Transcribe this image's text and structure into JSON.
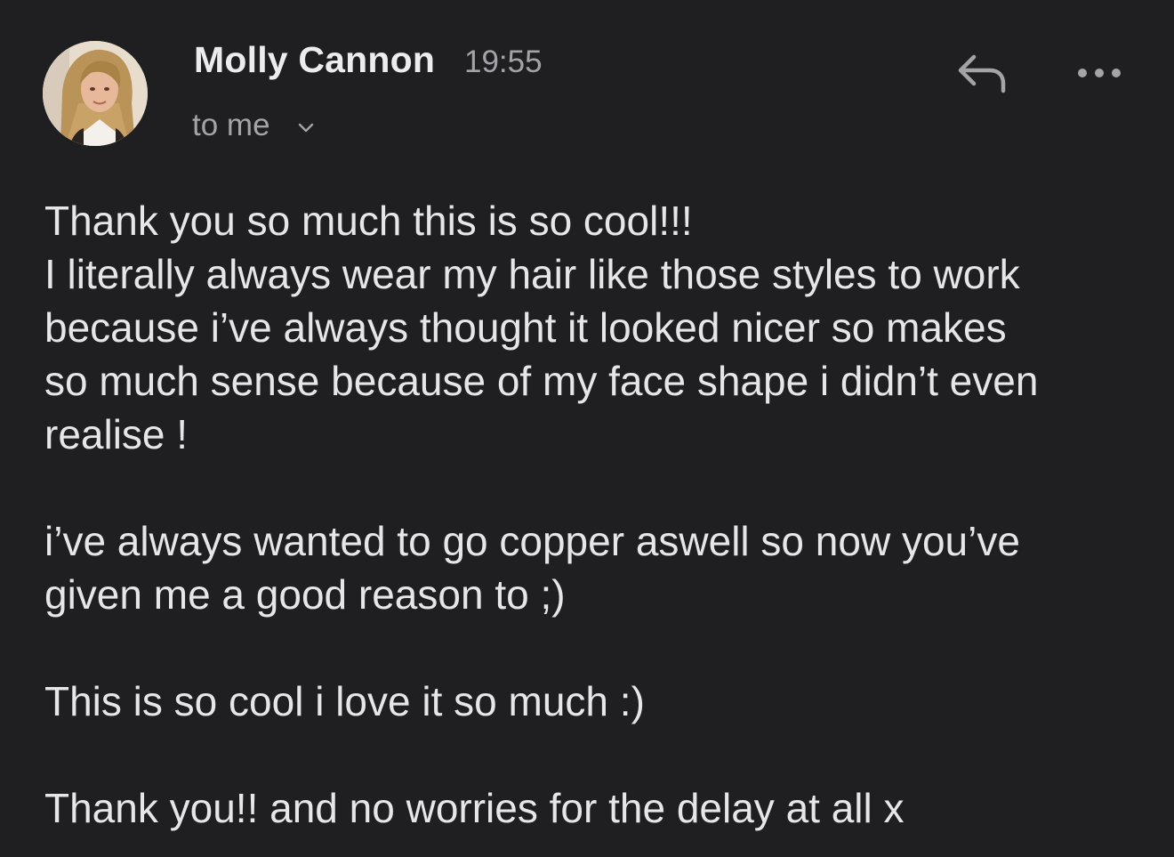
{
  "header": {
    "sender_name": "Molly Cannon",
    "time": "19:55",
    "recipient": "to me",
    "avatar_icon": "sender-photo",
    "reply_icon": "reply-arrow-icon",
    "more_icon": "more-horizontal-icon",
    "expand_icon": "chevron-down-icon"
  },
  "body": {
    "paragraphs": [
      "Thank you so much this is so cool!!!\nI literally always wear my hair like those styles to work\nbecause i’ve always thought it looked nicer so makes\nso much sense because of my face shape i didn’t even\nrealise !",
      "i’ve always wanted to go copper aswell so now you’ve\ngiven me a good reason to ;)",
      "This is so cool i love it so much :)",
      "Thank you!! and no worries for the delay at all x"
    ]
  },
  "colors": {
    "background": "#1f1f22",
    "primary_text": "#e6e6e8",
    "secondary_text": "#a3a3a8"
  }
}
